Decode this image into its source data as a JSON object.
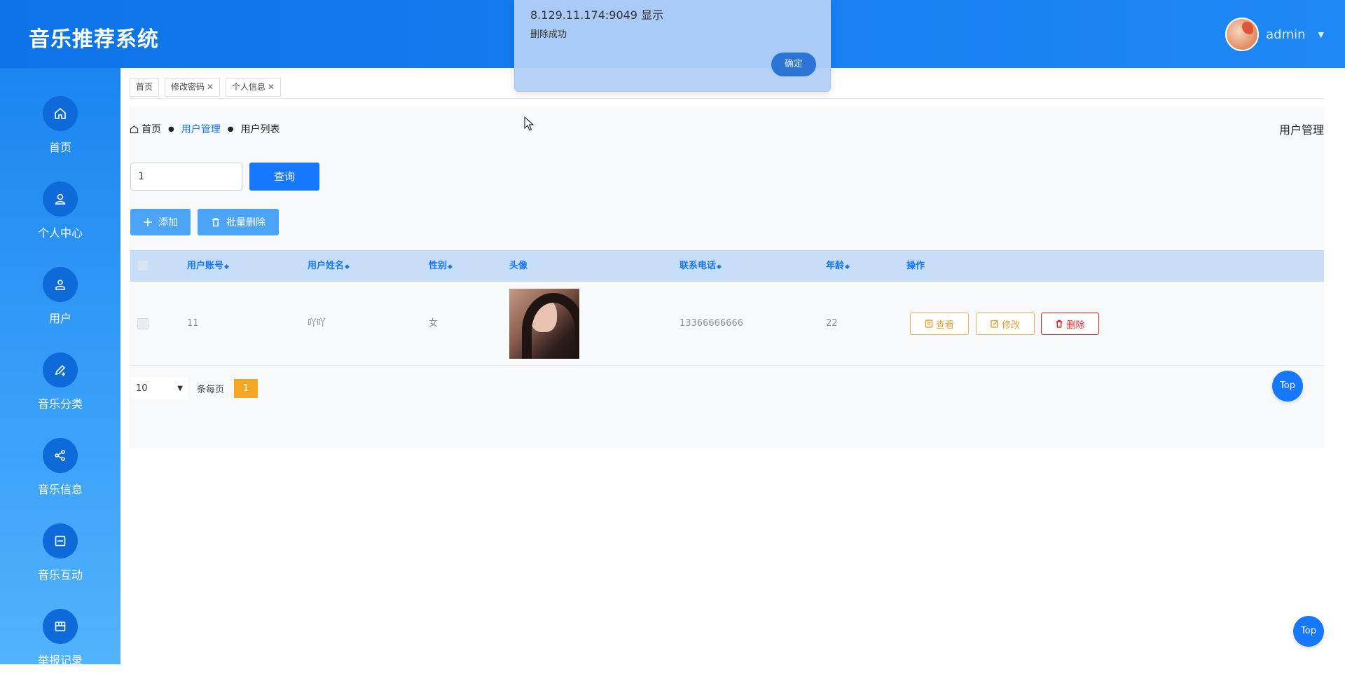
{
  "header": {
    "title": "音乐推荐系统",
    "username": "admin"
  },
  "sidebar": {
    "items": [
      {
        "label": "首页",
        "icon": "home-icon"
      },
      {
        "label": "个人中心",
        "icon": "user-icon"
      },
      {
        "label": "用户",
        "icon": "user-card-icon"
      },
      {
        "label": "音乐分类",
        "icon": "edit-icon"
      },
      {
        "label": "音乐信息",
        "icon": "share-icon"
      },
      {
        "label": "音乐互动",
        "icon": "box-icon"
      },
      {
        "label": "举报记录",
        "icon": "grid-icon"
      }
    ]
  },
  "tabs": [
    {
      "label": "首页",
      "closable": false
    },
    {
      "label": "修改密码",
      "closable": true
    },
    {
      "label": "个人信息",
      "closable": true
    }
  ],
  "breadcrumb": {
    "home": "首页",
    "section": "用户管理",
    "current": "用户列表",
    "right_title": "用户管理"
  },
  "search": {
    "value": "1",
    "button": "查询"
  },
  "actions": {
    "add": "添加",
    "bulk_delete": "批量删除"
  },
  "table": {
    "headers": [
      "用户账号",
      "用户姓名",
      "性别",
      "头像",
      "联系电话",
      "年龄",
      "操作"
    ],
    "rows": [
      {
        "account": "11",
        "name": "吖吖",
        "gender": "女",
        "phone": "13366666666",
        "age": "22"
      }
    ],
    "row_actions": {
      "view": "查看",
      "edit": "修改",
      "delete": "删除"
    }
  },
  "pagination": {
    "page_size": "10",
    "per_page_label": "条每页",
    "current_page": "1"
  },
  "top_button": "Top",
  "alert": {
    "title": "8.129.11.174:9049 显示",
    "message": "删除成功",
    "ok": "确定"
  },
  "colors": {
    "primary": "#1677ff",
    "header_bg": "#0d73e8",
    "warning": "#e0a33a",
    "danger": "#d9262c",
    "page_active": "#f5a623"
  }
}
